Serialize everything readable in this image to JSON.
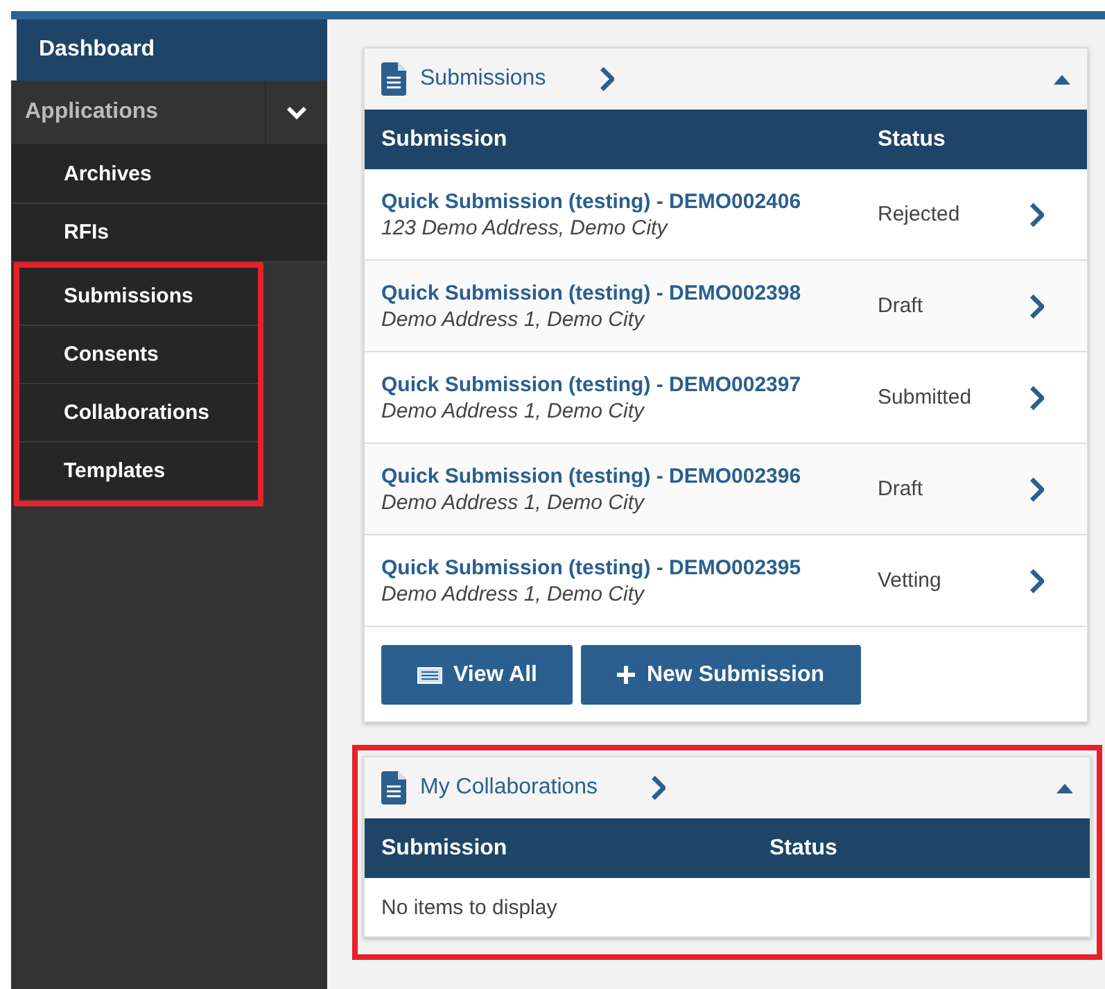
{
  "sidebar": {
    "items": [
      {
        "label": "Dashboard",
        "selected": true,
        "kind": "top"
      },
      {
        "label": "Applications",
        "selected": false,
        "kind": "group",
        "expanded": true,
        "children": [
          {
            "label": "Archives",
            "selected": false,
            "highlighted": false
          },
          {
            "label": "RFIs",
            "selected": false,
            "highlighted": false
          },
          {
            "label": "Submissions",
            "selected": false,
            "highlighted": true
          },
          {
            "label": "Consents",
            "selected": false,
            "highlighted": true
          },
          {
            "label": "Collaborations",
            "selected": false,
            "highlighted": true
          },
          {
            "label": "Templates",
            "selected": false,
            "highlighted": true
          }
        ]
      }
    ]
  },
  "panels": [
    {
      "title": "Submissions",
      "expanded": true,
      "highlighted": false,
      "columns": [
        "Submission",
        "Status"
      ],
      "rows": [
        {
          "title": "Quick Submission (testing) - DEMO002406",
          "address": "123 Demo Address, Demo City",
          "status": "Rejected"
        },
        {
          "title": "Quick Submission (testing) - DEMO002398",
          "address": "Demo Address 1, Demo City",
          "status": "Draft"
        },
        {
          "title": "Quick Submission (testing) - DEMO002397",
          "address": "Demo Address 1, Demo City",
          "status": "Submitted"
        },
        {
          "title": "Quick Submission (testing) - DEMO002396",
          "address": "Demo Address 1, Demo City",
          "status": "Draft"
        },
        {
          "title": "Quick Submission (testing) - DEMO002395",
          "address": "Demo Address 1, Demo City",
          "status": "Vetting"
        }
      ],
      "buttons": [
        {
          "label": "View All",
          "kind": "list"
        },
        {
          "label": "New Submission",
          "kind": "add"
        }
      ]
    },
    {
      "title": "My Collaborations",
      "expanded": true,
      "highlighted": true,
      "columns": [
        "Submission",
        "Status"
      ],
      "empty_text": "No items to display"
    }
  ]
}
